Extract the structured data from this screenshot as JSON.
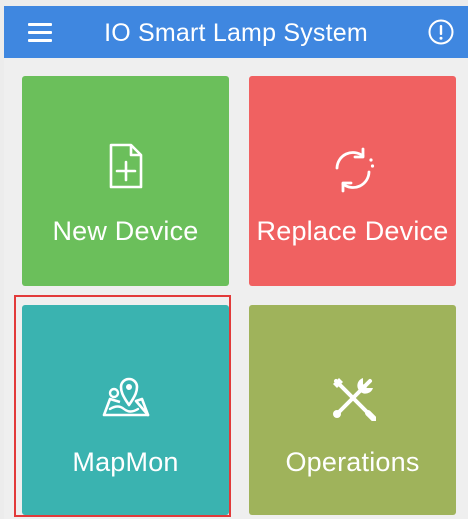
{
  "app": {
    "title": "IO Smart Lamp System",
    "accent_color": "#3f87e0"
  },
  "header": {
    "menu_icon": "hamburger-menu-icon",
    "info_icon": "info-circle-icon"
  },
  "tiles": [
    {
      "label": "New Device",
      "icon": "new-file-icon",
      "color": "#6bbf5b"
    },
    {
      "label": "Replace Device",
      "icon": "sync-icon",
      "color": "#f06161"
    },
    {
      "label": "MapMon",
      "icon": "map-pin-icon",
      "color": "#3ab3b0",
      "highlighted": true
    },
    {
      "label": "Operations",
      "icon": "tools-icon",
      "color": "#9fb35b"
    }
  ]
}
